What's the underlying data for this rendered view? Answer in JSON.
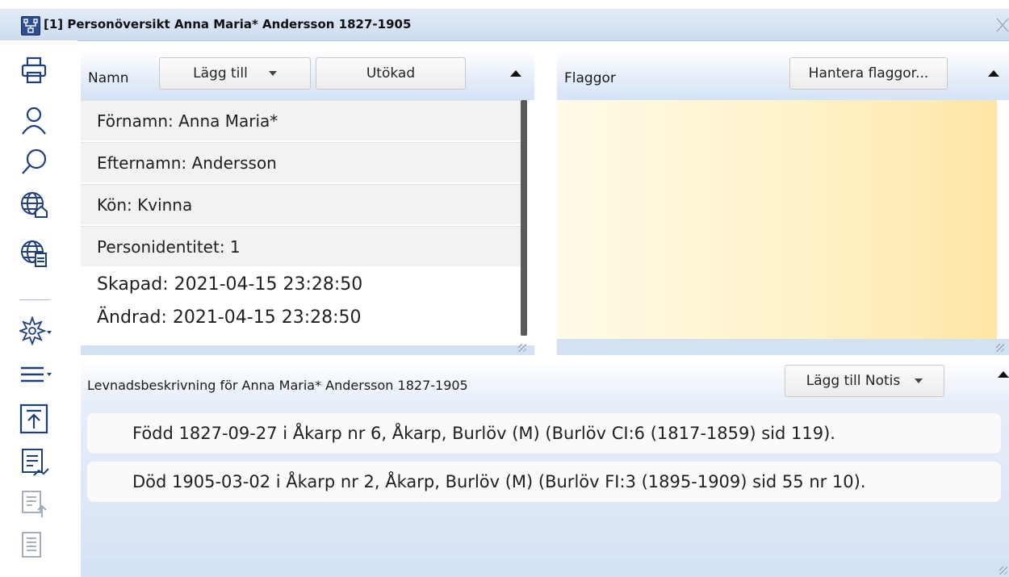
{
  "window": {
    "title": "[1] Personöversikt Anna Maria* Andersson 1827-1905",
    "app_icon": "family-tree-icon",
    "close_icon": "close-icon"
  },
  "toolbar": {
    "items": [
      "print-icon",
      "person-icon",
      "search-icon",
      "globe-house-icon",
      "globe-document-icon",
      "star-menu-icon",
      "list-menu-icon",
      "export-top-icon",
      "document-report-icon",
      "document-arrow-up-icon",
      "document-list-icon"
    ]
  },
  "namn_panel": {
    "label": "Namn",
    "add_button": "Lägg till",
    "extended_button": "Utökad",
    "rows": [
      "Förnamn: Anna Maria*",
      "Efternamn: Andersson",
      "Kön: Kvinna",
      "Personidentitet: 1"
    ],
    "created": "Skapad:  2021-04-15  23:28:50",
    "modified": "Ändrad:  2021-04-15  23:28:50"
  },
  "flag_panel": {
    "label": "Flaggor",
    "manage_button": "Hantera flaggor..."
  },
  "life_panel": {
    "title": "Levnadsbeskrivning för Anna Maria* Andersson 1827-1905",
    "add_note_button": "Lägg till Notis",
    "entries": [
      "Född 1827-09-27 i Åkarp nr 6, Åkarp, Burlöv (M) (Burlöv CI:6 (1817-1859) sid 119).",
      "Död 1905-03-02 i Åkarp nr 2, Åkarp, Burlöv (M) (Burlöv FI:3 (1895-1909) sid 55 nr 10)."
    ]
  },
  "colors": {
    "header_blue": "#d4e2f4",
    "flag_yellow": "#ffe6a6",
    "icon_navy": "#1f3f7a"
  }
}
